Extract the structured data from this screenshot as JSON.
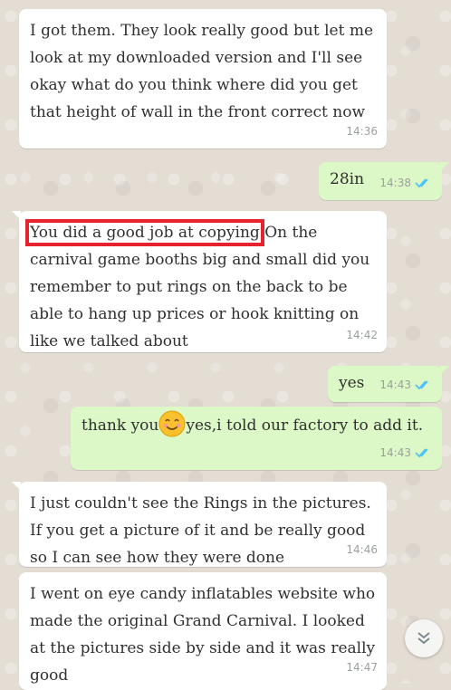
{
  "messages": [
    {
      "dir": "in",
      "text": "I got them. They look really good but let me look at my downloaded version and I'll see okay what do you think where did you get that height of wall in the front correct now",
      "time": "14:36"
    },
    {
      "dir": "out",
      "text": "28in",
      "time": "14:38"
    },
    {
      "dir": "in",
      "highlight": "You did a good job at copying",
      "text": " On the carnival game booths big and small did you remember to put rings on the back to be able to hang up prices or hook knitting on like we talked about",
      "time": "14:42"
    },
    {
      "dir": "out",
      "text": "yes",
      "time": "14:43"
    },
    {
      "dir": "out",
      "text_before": "thank you",
      "emoji": "smiling-face-with-smiling-eyes",
      "text_after": "yes,i told our factory to add it.",
      "time": "14:43"
    },
    {
      "dir": "in",
      "text": "I just couldn't see the Rings in the pictures. If you get a picture of it and be really good so I can see how they were done",
      "time": "14:46"
    },
    {
      "dir": "in",
      "text": "I went on eye candy inflatables website who made the original Grand Carnival. I looked at the pictures side by side and it was really good",
      "time": "14:47"
    }
  ],
  "colors": {
    "incoming": "#ffffff",
    "outgoing": "#dcf8c6",
    "read_ticks": "#4fc3f7",
    "highlight": "#e5232d"
  },
  "icons": {
    "read_receipt": "double-check-icon",
    "scroll": "chevron-down-icon"
  }
}
